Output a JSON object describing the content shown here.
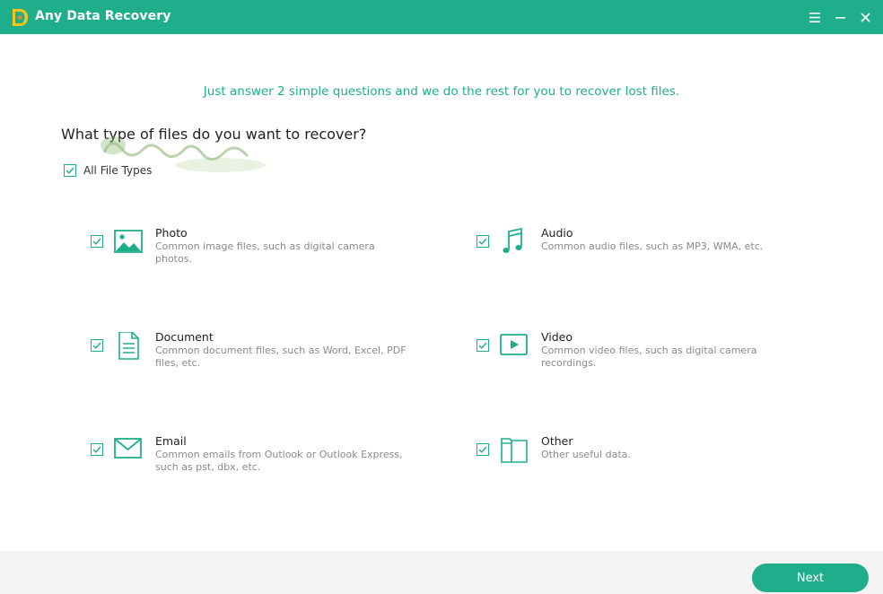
{
  "app": {
    "title": "Any Data Recovery",
    "accent": "#1fae8c"
  },
  "window_controls": {
    "menu": "menu-icon",
    "minimize": "minimize-icon",
    "close": "close-icon"
  },
  "main": {
    "subtitle": "Just answer 2 simple questions and we do the rest for you to recover lost files.",
    "question": "What type of files do you want to recover?",
    "all_types": {
      "label": "All File Types",
      "checked": true
    },
    "types": [
      {
        "name": "Photo",
        "desc": "Common image files, such as digital camera photos.",
        "icon": "photo-icon",
        "checked": true
      },
      {
        "name": "Audio",
        "desc": "Common audio files, such as MP3, WMA, etc.",
        "icon": "music-note-icon",
        "checked": true
      },
      {
        "name": "Document",
        "desc": "Common document files, such as Word, Excel, PDF files, etc.",
        "icon": "document-icon",
        "checked": true
      },
      {
        "name": "Video",
        "desc": "Common video files, such as digital camera recordings.",
        "icon": "video-play-icon",
        "checked": true
      },
      {
        "name": "Email",
        "desc": "Common emails from Outlook or Outlook Express, such as pst, dbx, etc.",
        "icon": "envelope-icon",
        "checked": true
      },
      {
        "name": "Other",
        "desc": "Other useful data.",
        "icon": "folder-icon",
        "checked": true
      }
    ]
  },
  "footer": {
    "next_label": "Next"
  }
}
